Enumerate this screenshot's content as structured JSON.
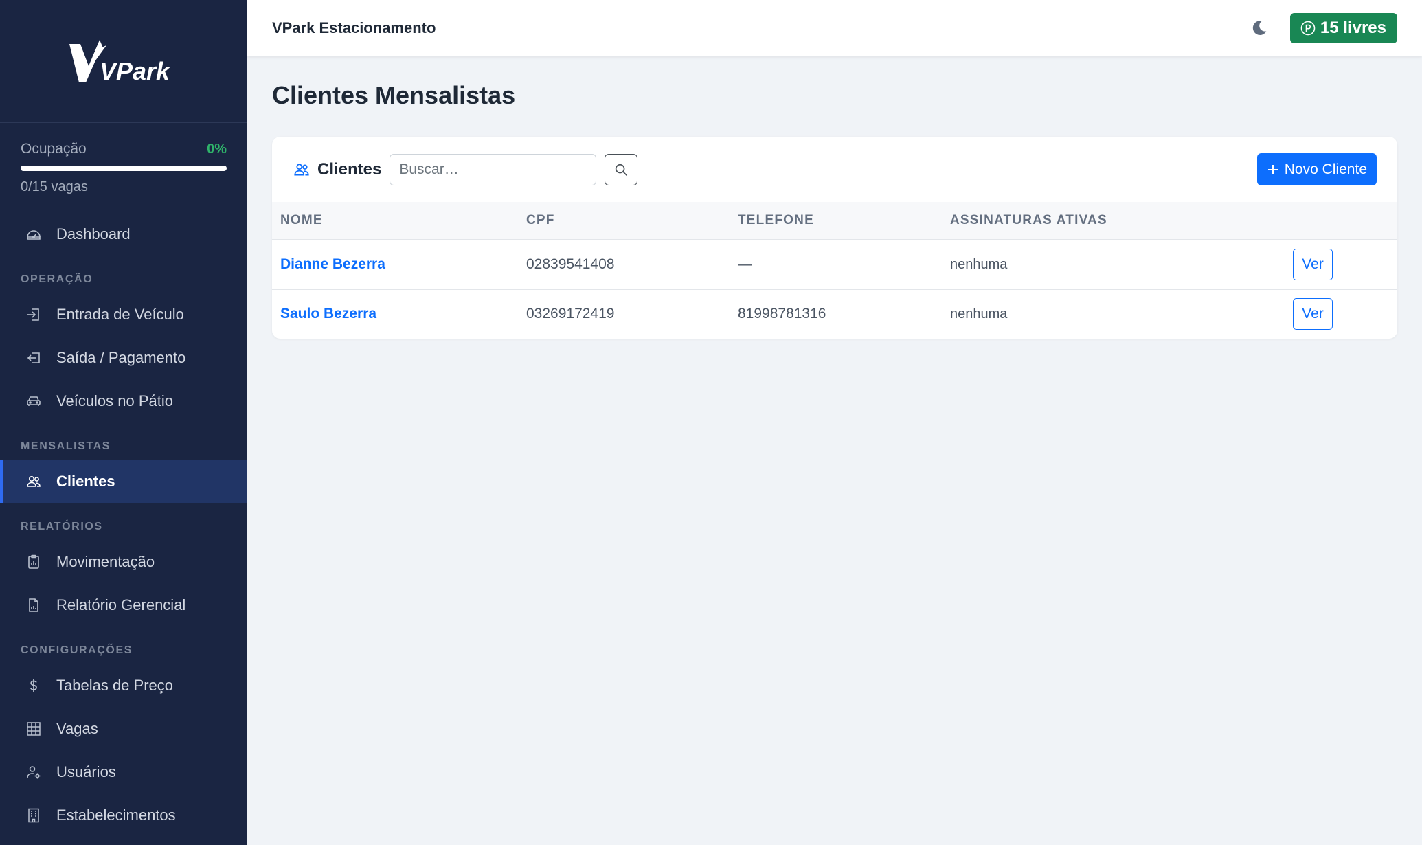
{
  "brand": {
    "logo_text": "VPark",
    "app_title": "VPark Estacionamento"
  },
  "occupancy": {
    "label": "Ocupação",
    "percent_text": "0%",
    "percent_value": 0,
    "spots_text": "0/15 vagas"
  },
  "sidebar": {
    "dashboard": {
      "label": "Dashboard",
      "icon": "speedometer-icon"
    },
    "sections": {
      "operacao": "OPERAÇÃO",
      "mensalistas": "MENSALISTAS",
      "relatorios": "RELATÓRIOS",
      "configuracoes": "CONFIGURAÇÕES"
    },
    "items": {
      "entrada": {
        "label": "Entrada de Veículo",
        "icon": "box-arrow-in-icon"
      },
      "saida": {
        "label": "Saída / Pagamento",
        "icon": "box-arrow-out-icon"
      },
      "veiculos": {
        "label": "Veículos no Pátio",
        "icon": "car-icon"
      },
      "clientes": {
        "label": "Clientes",
        "icon": "people-icon",
        "active": true
      },
      "movimentacao": {
        "label": "Movimentação",
        "icon": "clipboard-data-icon"
      },
      "relatorio": {
        "label": "Relatório Gerencial",
        "icon": "file-bar-chart-icon"
      },
      "tabelas": {
        "label": "Tabelas de Preço",
        "icon": "dollar-icon"
      },
      "vagas": {
        "label": "Vagas",
        "icon": "grid-icon"
      },
      "usuarios": {
        "label": "Usuários",
        "icon": "person-gear-icon"
      },
      "estabelecimentos": {
        "label": "Estabelecimentos",
        "icon": "building-icon"
      }
    }
  },
  "topbar": {
    "theme_icon": "moon-icon",
    "free_spots_label": "15 livres",
    "free_icon": "parking-circle-icon",
    "free_color": "#198754"
  },
  "page": {
    "title": "Clientes Mensalistas",
    "card_title": "Clientes",
    "search": {
      "placeholder": "Buscar…",
      "value": ""
    },
    "new_button": "Novo Cliente",
    "columns": {
      "nome": "NOME",
      "cpf": "CPF",
      "telefone": "TELEFONE",
      "assinaturas": "ASSINATURAS ATIVAS"
    },
    "rows": [
      {
        "nome": "Dianne Bezerra",
        "cpf": "02839541408",
        "telefone": "—",
        "assinaturas": "nenhuma",
        "action": "Ver"
      },
      {
        "nome": "Saulo Bezerra",
        "cpf": "03269172419",
        "telefone": "81998781316",
        "assinaturas": "nenhuma",
        "action": "Ver"
      }
    ]
  },
  "colors": {
    "sidebar_bg": "#1a2542",
    "accent": "#0d6efd",
    "success": "#198754",
    "active_item_bg": "#213566"
  }
}
